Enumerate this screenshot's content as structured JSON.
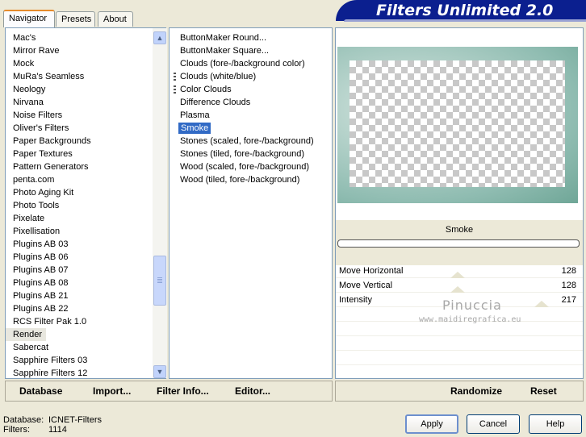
{
  "tabs": [
    {
      "label": "Navigator",
      "active": true
    },
    {
      "label": "Presets",
      "active": false
    },
    {
      "label": "About",
      "active": false
    }
  ],
  "banner": {
    "title": "Filters Unlimited 2.0"
  },
  "categories": [
    "Mac's",
    "Mirror Rave",
    "Mock",
    "MuRa's Seamless",
    "Neology",
    "Nirvana",
    "Noise Filters",
    "Oliver's Filters",
    "Paper Backgrounds",
    "Paper Textures",
    "Pattern Generators",
    "penta.com",
    "Photo Aging Kit",
    "Photo Tools",
    "Pixelate",
    "Pixellisation",
    "Plugins AB 03",
    "Plugins AB 06",
    "Plugins AB 07",
    "Plugins AB 08",
    "Plugins AB 21",
    "Plugins AB 22",
    "RCS Filter Pak 1.0",
    "Render",
    "Sabercat",
    "Sapphire Filters 03",
    "Sapphire Filters 12"
  ],
  "filters": [
    {
      "label": "ButtonMaker Round...",
      "marked": false
    },
    {
      "label": "ButtonMaker Square...",
      "marked": false
    },
    {
      "label": "Clouds (fore-/background color)",
      "marked": false
    },
    {
      "label": "Clouds (white/blue)",
      "marked": true
    },
    {
      "label": "Color Clouds",
      "marked": true
    },
    {
      "label": "Difference Clouds",
      "marked": false
    },
    {
      "label": "Plasma",
      "marked": false
    },
    {
      "label": "Smoke",
      "marked": false,
      "selected": true
    },
    {
      "label": "Stones (scaled, fore-/background)",
      "marked": false
    },
    {
      "label": "Stones (tiled, fore-/background)",
      "marked": false
    },
    {
      "label": "Wood (scaled, fore-/background)",
      "marked": false
    },
    {
      "label": "Wood (tiled, fore-/background)",
      "marked": false
    }
  ],
  "preview": {
    "filter_name": "Smoke"
  },
  "params": [
    {
      "label": "Move Horizontal",
      "value": "128"
    },
    {
      "label": "Move Vertical",
      "value": "128"
    },
    {
      "label": "Intensity",
      "value": "217"
    }
  ],
  "watermark": {
    "name": "Pinuccia",
    "url": "www.maidiregrafica.eu"
  },
  "toolbar": {
    "database": "Database",
    "import": "Import...",
    "filter_info": "Filter Info...",
    "editor": "Editor...",
    "randomize": "Randomize",
    "reset": "Reset"
  },
  "status": {
    "database_label": "Database:",
    "database_value": "ICNET-Filters",
    "filters_label": "Filters:",
    "filters_value": "1114"
  },
  "buttons": {
    "apply": "Apply",
    "cancel": "Cancel",
    "help": "Help"
  },
  "colors": {
    "banner": "#0b1f8f",
    "selection": "#316ac5",
    "tab_accent": "#e68b2c"
  }
}
